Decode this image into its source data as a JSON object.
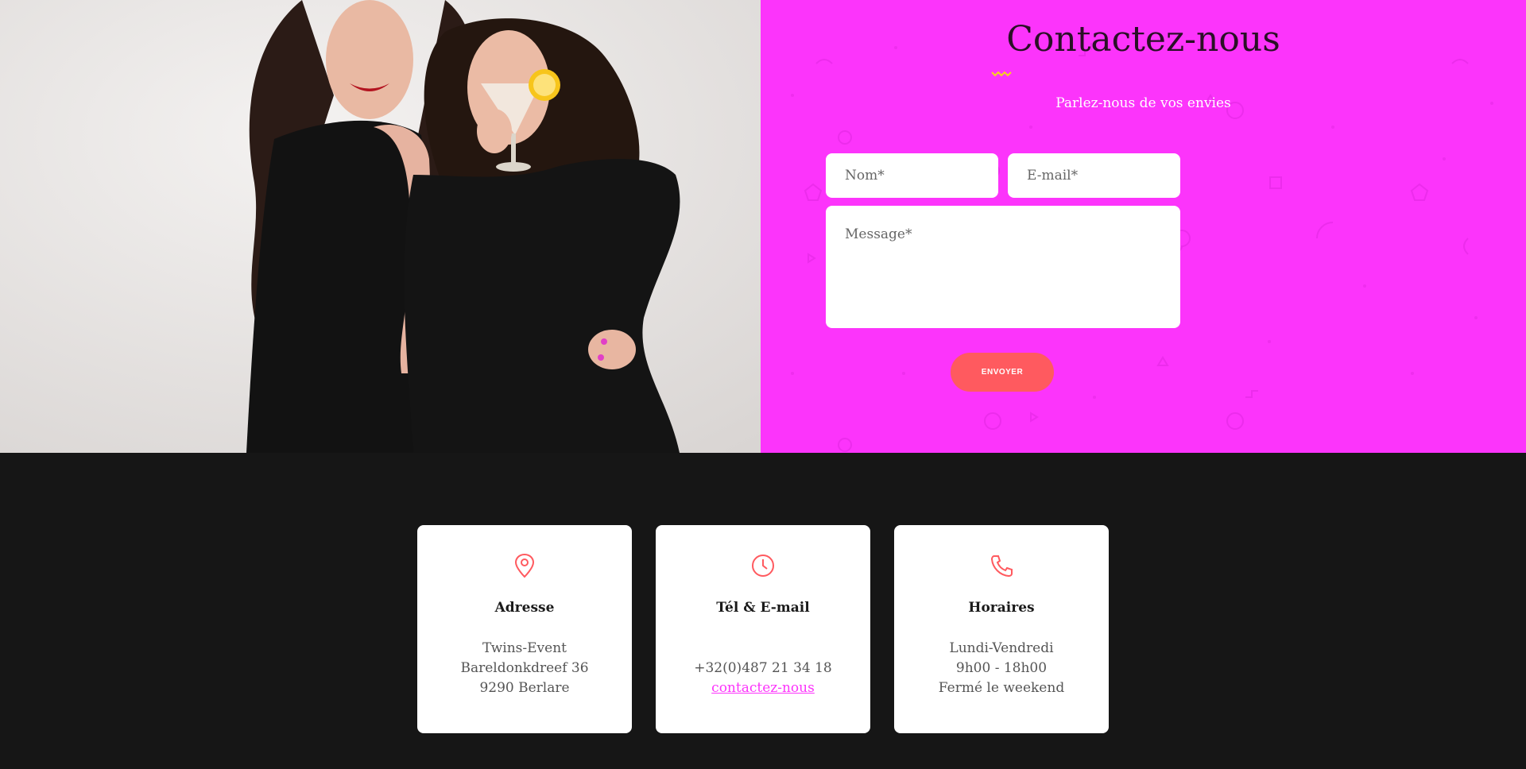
{
  "contact": {
    "title": "Contactez-nous",
    "subtitle": "Parlez-nous de vos envies",
    "name_placeholder": "Nom*",
    "email_placeholder": "E-mail*",
    "message_placeholder": "Message*",
    "send_label": "ENVOYER"
  },
  "cards": [
    {
      "icon": "map-pin-icon",
      "title": "Adresse",
      "lines": [
        "Twins-Event",
        "Bareldonkdreef 36",
        "9290 Berlare"
      ]
    },
    {
      "icon": "clock-icon",
      "title": "Tél & E-mail",
      "lines": [
        "+32(0)487 21 34 18",
        "contactez-nous"
      ]
    },
    {
      "icon": "phone-icon",
      "title": "Horaires",
      "lines": [
        "Lundi-Vendredi",
        "9h00 - 18h00",
        "Fermé le weekend"
      ]
    }
  ],
  "colors": {
    "accent": "#fc34fb",
    "button": "#ff5a5f",
    "icon": "#ff5a5f",
    "dark": "#161616"
  }
}
